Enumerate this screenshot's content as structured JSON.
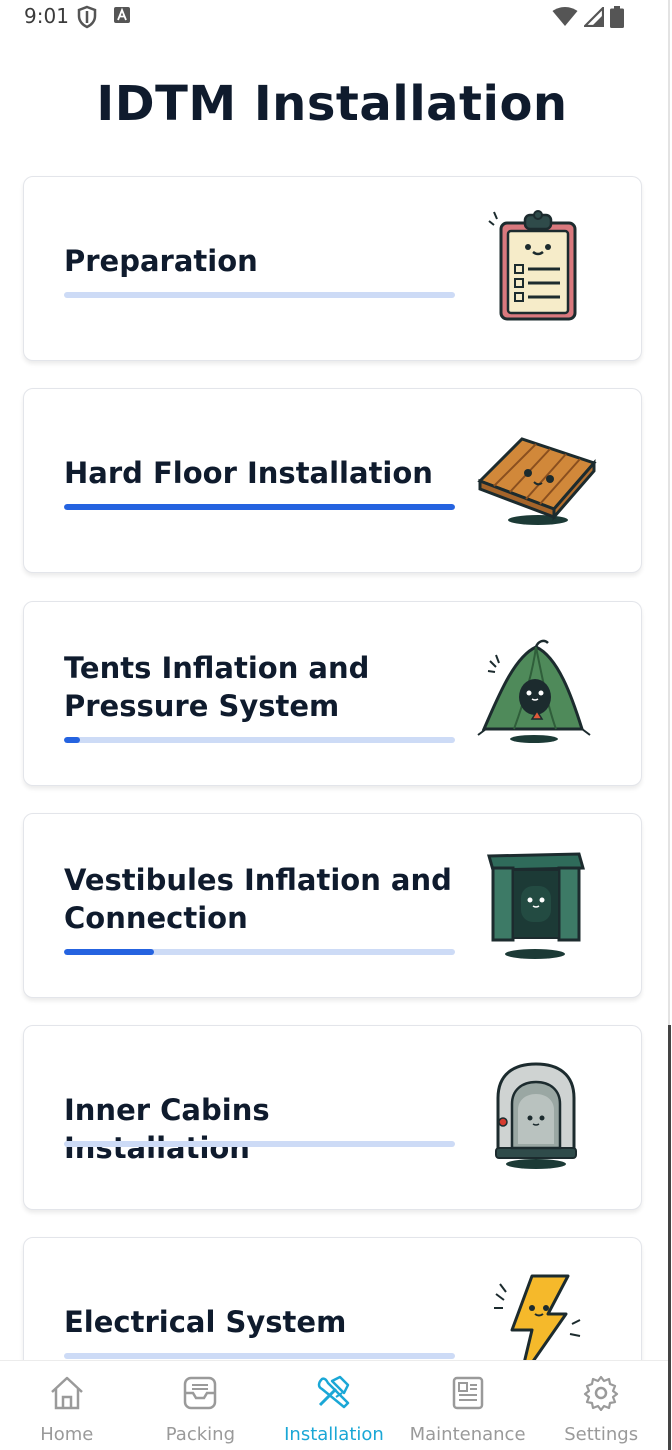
{
  "status_bar": {
    "time": "9:01"
  },
  "page": {
    "title": "IDTM Installation"
  },
  "sections": [
    {
      "title": "Preparation",
      "progress": 0.0,
      "illustration": "clipboard-checklist-icon"
    },
    {
      "title": "Hard Floor Installation",
      "progress": 1.0,
      "illustration": "wooden-floor-panel-icon"
    },
    {
      "title": "Tents Inflation and Pressure System",
      "progress": 0.04,
      "illustration": "green-tent-icon"
    },
    {
      "title": "Vestibules Inflation and Connection",
      "progress": 0.23,
      "illustration": "vestibule-frame-icon"
    },
    {
      "title": "Inner Cabins Installation",
      "progress": 0.0,
      "illustration": "cabin-pod-icon"
    },
    {
      "title": "Electrical System",
      "progress": 0.0,
      "illustration": "lightning-bolt-icon"
    }
  ],
  "bottom_nav": {
    "items": [
      {
        "label": "Home",
        "icon": "home-icon",
        "active": false
      },
      {
        "label": "Packing",
        "icon": "box-icon",
        "active": false
      },
      {
        "label": "Installation",
        "icon": "tools-icon",
        "active": true
      },
      {
        "label": "Maintenance",
        "icon": "document-icon",
        "active": false
      },
      {
        "label": "Settings",
        "icon": "gear-icon",
        "active": false
      }
    ]
  },
  "colors": {
    "progress_fill": "#2563e0",
    "progress_track": "#cddbf6",
    "nav_active": "#1aa7d6",
    "nav_inactive": "#9a9a9a"
  }
}
